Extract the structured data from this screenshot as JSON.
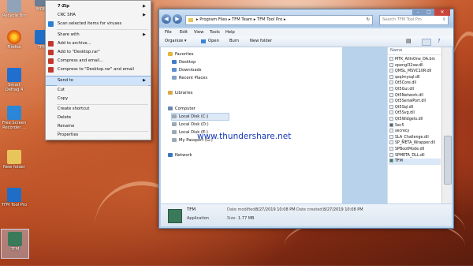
{
  "desktop": {
    "icons": [
      {
        "label": "Recycle Bin",
        "color": "#8fa4b8"
      },
      {
        "label": "Firefox",
        "color": "#e66000"
      },
      {
        "label": "Smart Defrag 4",
        "color": "#1f6fd0"
      },
      {
        "label": "Free Screen Recorder ...",
        "color": "#2a86d6"
      },
      {
        "label": "New folder",
        "color": "#e8c55a"
      },
      {
        "label": "TFM Tool Pro",
        "color": "#1e6ec8"
      },
      {
        "label": "TFM",
        "color": "#3a7a5a"
      }
    ],
    "partial_icon_labels": [
      "MOBI",
      "TFM"
    ]
  },
  "context_menu": {
    "items": [
      {
        "label": "7-Zip",
        "bold": true,
        "submenu": true
      },
      {
        "label": "CRC SHA",
        "submenu": true
      },
      {
        "label": "Scan selected items for viruses",
        "icon": "shield-icon"
      },
      {
        "label": "Share with",
        "submenu": true
      },
      {
        "label": "Add to archive...",
        "icon": "winrar-icon"
      },
      {
        "label": "Add to \"Desktop.rar\"",
        "icon": "winrar-icon"
      },
      {
        "label": "Compress and email...",
        "icon": "winrar-icon"
      },
      {
        "label": "Compress to \"Desktop.rar\" and email",
        "icon": "winrar-icon"
      },
      {
        "label": "Send to",
        "submenu": true,
        "selected": true
      },
      {
        "label": "Cut"
      },
      {
        "label": "Copy"
      },
      {
        "label": "Create shortcut"
      },
      {
        "label": "Delete"
      },
      {
        "label": "Rename"
      },
      {
        "label": "Properties"
      }
    ]
  },
  "explorer": {
    "breadcrumb": [
      "Program Files",
      "TFM Team",
      "TFM Tool Pro"
    ],
    "search_placeholder": "Search TFM Tool Pro",
    "menubar": [
      "File",
      "Edit",
      "View",
      "Tools",
      "Help"
    ],
    "toolbar": {
      "organize": "Organize ▾",
      "open": "Open",
      "burn": "Burn",
      "new_folder": "New folder"
    },
    "nav": {
      "favorites_label": "Favorites",
      "favorites": [
        "Desktop",
        "Downloads",
        "Recent Places"
      ],
      "libraries_label": "Libraries",
      "computer_label": "Computer",
      "drives": [
        "Local Disk (C:)",
        "Local Disk (D:)",
        "Local Disk (E:)",
        "My Passport (G:)"
      ],
      "network_label": "Network"
    },
    "files": {
      "column": "Name",
      "items": [
        "MTK_AllInOne_DA.bin",
        "opengl32sw.dll",
        "QMSL_MSVC10R.dll",
        "qsqlmysql.dll",
        "Qt5Core.dll",
        "Qt5Gui.dll",
        "Qt5Network.dll",
        "Qt5SerialPort.dll",
        "Qt5Sql.dll",
        "Qt5Svg.dll",
        "Qt5Widgets.dll",
        "Sec5",
        "secrecy",
        "SLA_Challenge.dll",
        "SP_META_Wrapper.dll",
        "SPBootMode.dll",
        "SPMETA_DLL.dll",
        "TFM"
      ],
      "selected": "TFM"
    },
    "details": {
      "name": "TFM",
      "type": "Application",
      "modified_label": "Date modified:",
      "modified": "8/27/2019 10:08 PM",
      "created_label": "Date created:",
      "created": "8/27/2019 10:08 PM",
      "size_label": "Size:",
      "size": "1.77 MB"
    }
  },
  "watermark": "www.thundershare.net"
}
